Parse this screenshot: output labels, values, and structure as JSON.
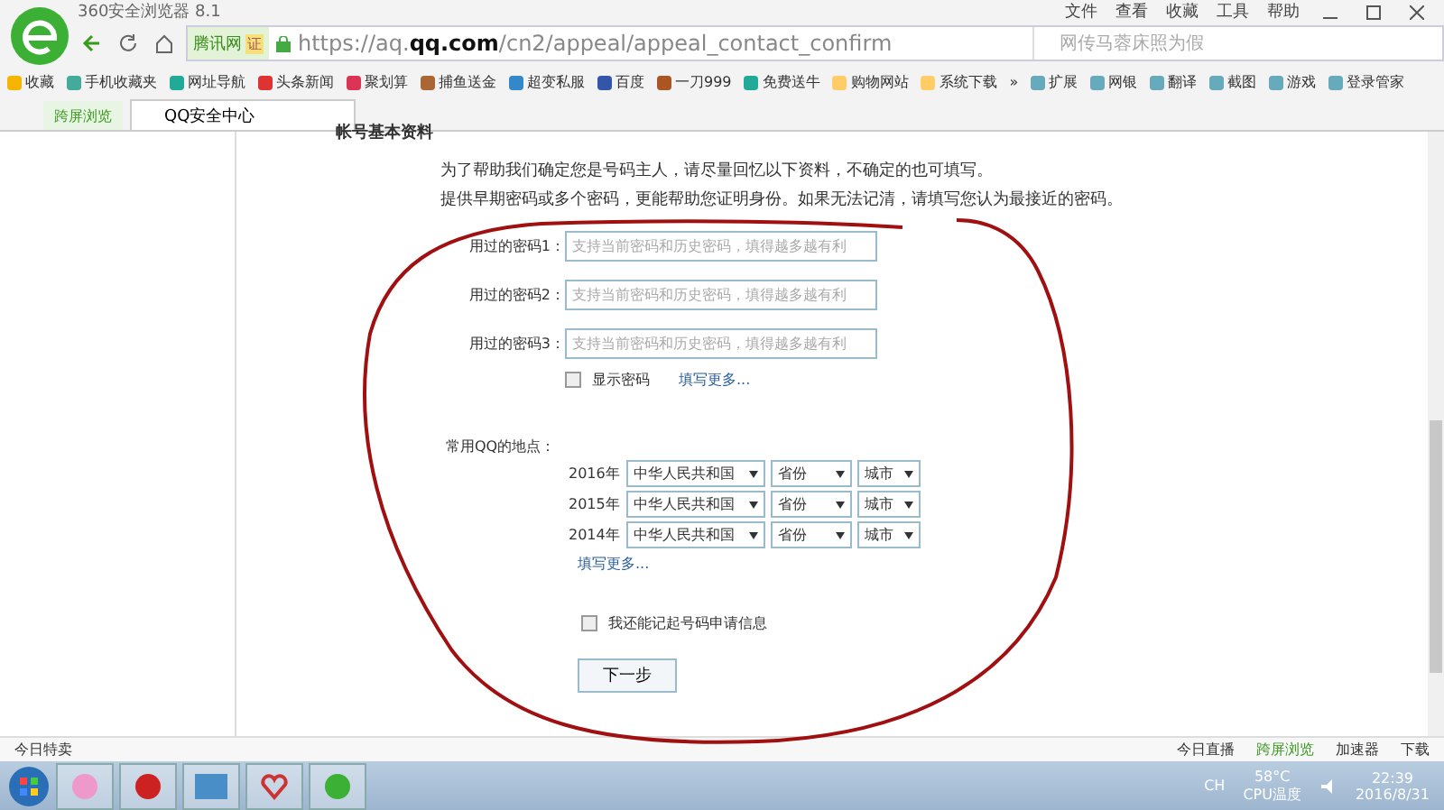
{
  "browser": {
    "title": "360安全浏览器 8.1",
    "menu": [
      "文件",
      "查看",
      "收藏",
      "工具",
      "帮助"
    ],
    "site_label": "腾讯网",
    "cert": "证",
    "url": "https://aq.**qq.com**/cn2/appeal/appeal_contact_confirm",
    "search_placeholder": "网传马蓉床照为假"
  },
  "bookmarks": [
    "收藏",
    "手机收藏夹",
    "网址导航",
    "头条新闻",
    "聚划算",
    "捕鱼送金",
    "超变私服",
    "百度",
    "一刀999",
    "免费送牛",
    "购物网站",
    "系统下载"
  ],
  "bookmarks_more": "»",
  "extensions": [
    "扩展",
    "网银",
    "翻译",
    "截图",
    "游戏",
    "登录管家"
  ],
  "side_button": "跨屏浏览",
  "tabs": [
    {
      "label": "QQ安全中心",
      "selected": true
    }
  ],
  "page": {
    "section_title": "帐号基本资料",
    "intro": [
      "为了帮助我们确定您是号码主人，请尽量回忆以下资料，不确定的也可填写。",
      "提供早期密码或多个密码，更能帮助您证明身份。如果无法记清，请填写您认为最接近的密码。"
    ],
    "passwords": [
      {
        "label": "用过的密码1：",
        "placeholder": "支持当前密码和历史密码，填得越多越有利"
      },
      {
        "label": "用过的密码2：",
        "placeholder": "支持当前密码和历史密码，填得越多越有利"
      },
      {
        "label": "用过的密码3：",
        "placeholder": "支持当前密码和历史密码，填得越多越有利"
      }
    ],
    "show_password": {
      "label": "显示密码",
      "checked": false
    },
    "passwords_more": "填写更多...",
    "locations_label": "常用QQ的地点：",
    "locations": [
      {
        "year": "2016年",
        "country": "中华人民共和国",
        "province": "省份",
        "city": "城市"
      },
      {
        "year": "2015年",
        "country": "中华人民共和国",
        "province": "省份",
        "city": "城市"
      },
      {
        "year": "2014年",
        "country": "中华人民共和国",
        "province": "省份",
        "city": "城市"
      }
    ],
    "locations_more": "填写更多...",
    "remember": {
      "label": "我还能记起号码申请信息",
      "checked": false
    },
    "next_button": "下一步"
  },
  "status_bar": {
    "left": "今日特卖",
    "items": [
      "今日直播",
      "跨屏浏览",
      "加速器",
      "下载"
    ]
  },
  "taskbar": {
    "lang": "CH",
    "temperature": "58°C",
    "temperature_label": "CPU温度",
    "time": "22:39",
    "date": "2016/8/31"
  }
}
